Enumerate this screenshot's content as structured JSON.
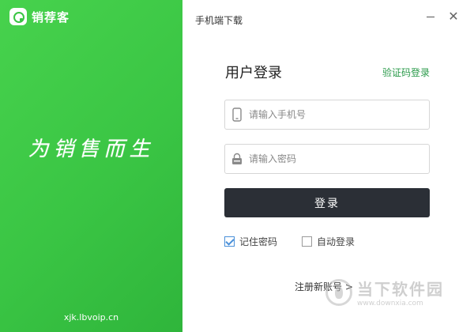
{
  "brand": {
    "name": "销荐客"
  },
  "left": {
    "slogan": "为销售而生",
    "url": "xjk.lbvoip.cn"
  },
  "header": {
    "mobile_download": "手机端下载"
  },
  "window": {
    "close_symbol": "✕"
  },
  "login": {
    "title": "用户登录",
    "code_login": "验证码登录",
    "phone_placeholder": "请输入手机号",
    "password_placeholder": "请输入密码",
    "submit": "登录",
    "remember_label": "记住密码",
    "remember_checked": true,
    "auto_label": "自动登录",
    "auto_checked": false,
    "register": "注册新账号 >"
  },
  "watermark": {
    "cn": "当下软件园",
    "en": "www.downxia.com"
  },
  "colors": {
    "brand_green": "#3ac544",
    "button_dark": "#2b2f36",
    "link_green": "#2a9a4a"
  },
  "icons": [
    "phone-icon",
    "lock-icon",
    "minimize-icon",
    "close-icon",
    "checkbox-checked-icon"
  ]
}
